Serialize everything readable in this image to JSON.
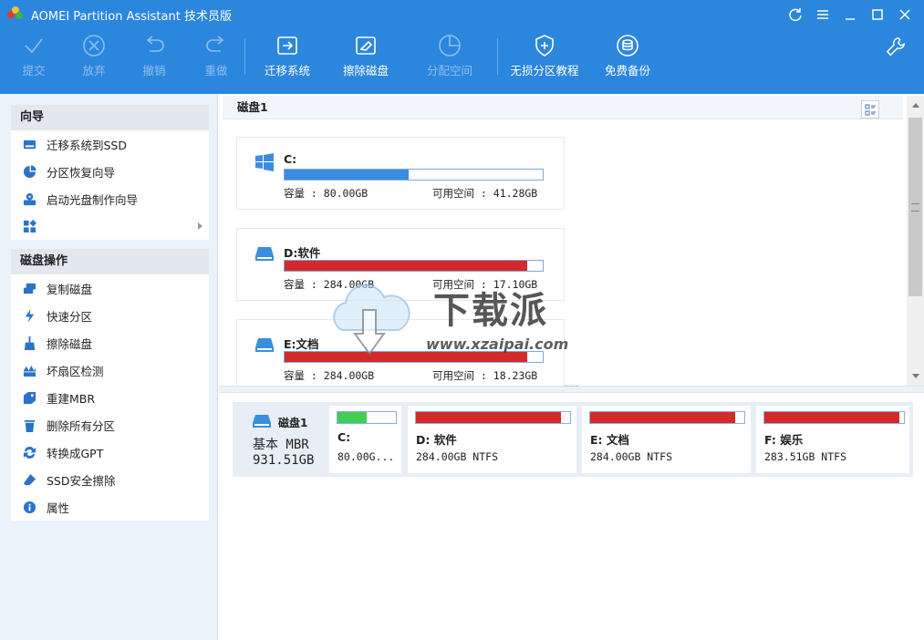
{
  "window": {
    "title": "AOMEI Partition Assistant 技术员版"
  },
  "toolbar": {
    "items": [
      {
        "label": "提交",
        "icon": "check-icon",
        "enabled": false
      },
      {
        "label": "放弃",
        "icon": "discard-icon",
        "enabled": false
      },
      {
        "label": "撤销",
        "icon": "undo-icon",
        "enabled": false
      },
      {
        "label": "重做",
        "icon": "redo-icon",
        "enabled": false
      },
      {
        "label": "迁移系统",
        "icon": "migrate-os-icon",
        "enabled": true
      },
      {
        "label": "擦除磁盘",
        "icon": "wipe-disk-icon",
        "enabled": true
      },
      {
        "label": "分配空间",
        "icon": "allocate-space-icon",
        "enabled": false
      },
      {
        "label": "无损分区教程",
        "icon": "shield-plus-icon",
        "enabled": true
      },
      {
        "label": "免费备份",
        "icon": "backup-icon",
        "enabled": true
      }
    ]
  },
  "sidebar": {
    "wizards": {
      "title": "向导",
      "items": [
        {
          "label": "迁移系统到SSD",
          "icon": "migrate-ssd-icon"
        },
        {
          "label": "分区恢复向导",
          "icon": "partition-recovery-icon"
        },
        {
          "label": "启动光盘制作向导",
          "icon": "bootable-media-icon"
        },
        {
          "label": "",
          "icon": "more-apps-icon"
        }
      ]
    },
    "disk_ops": {
      "title": "磁盘操作",
      "items": [
        {
          "label": "复制磁盘",
          "icon": "copy-disk-icon"
        },
        {
          "label": "快速分区",
          "icon": "quick-partition-icon"
        },
        {
          "label": "擦除磁盘",
          "icon": "wipe-disk-icon"
        },
        {
          "label": "坏扇区检测",
          "icon": "bad-sector-icon"
        },
        {
          "label": "重建MBR",
          "icon": "rebuild-mbr-icon"
        },
        {
          "label": "删除所有分区",
          "icon": "delete-all-partitions-icon"
        },
        {
          "label": "转换成GPT",
          "icon": "convert-gpt-icon"
        },
        {
          "label": "SSD安全擦除",
          "icon": "ssd-secure-erase-icon"
        },
        {
          "label": "属性",
          "icon": "info-icon"
        }
      ]
    }
  },
  "main": {
    "disk_title": "磁盘1",
    "partitions": [
      {
        "name": "C:",
        "capacity": "容量 : 80.00GB",
        "free": "可用空间 : 41.28GB",
        "used_fraction": 0.48,
        "color": "#3b8de0",
        "icon": "windows-icon"
      },
      {
        "name": "D:软件",
        "capacity": "容量 : 284.00GB",
        "free": "可用空间 : 17.10GB",
        "used_fraction": 0.94,
        "color": "#d42a2a",
        "icon": "drive-icon"
      },
      {
        "name": "E:文档",
        "capacity": "容量 : 284.00GB",
        "free": "可用空间 : 18.23GB",
        "used_fraction": 0.94,
        "color": "#d42a2a",
        "icon": "drive-icon"
      }
    ]
  },
  "watermark": {
    "text": "下载派",
    "url": "www.xzaipai.com"
  },
  "disk_map": {
    "name": "磁盘1",
    "type": "基本 MBR",
    "size": "931.51GB",
    "partitions": [
      {
        "name": "C:",
        "desc": "80.00G...",
        "used_fraction": 0.5,
        "color": "#3fcf52"
      },
      {
        "name": "D: 软件",
        "desc": "284.00GB NTFS",
        "used_fraction": 0.94,
        "color": "#d42a2a"
      },
      {
        "name": "E: 文档",
        "desc": "284.00GB NTFS",
        "used_fraction": 0.94,
        "color": "#d42a2a"
      },
      {
        "name": "F: 娱乐",
        "desc": "283.51GB NTFS",
        "used_fraction": 0.97,
        "color": "#d42a2a"
      }
    ]
  }
}
